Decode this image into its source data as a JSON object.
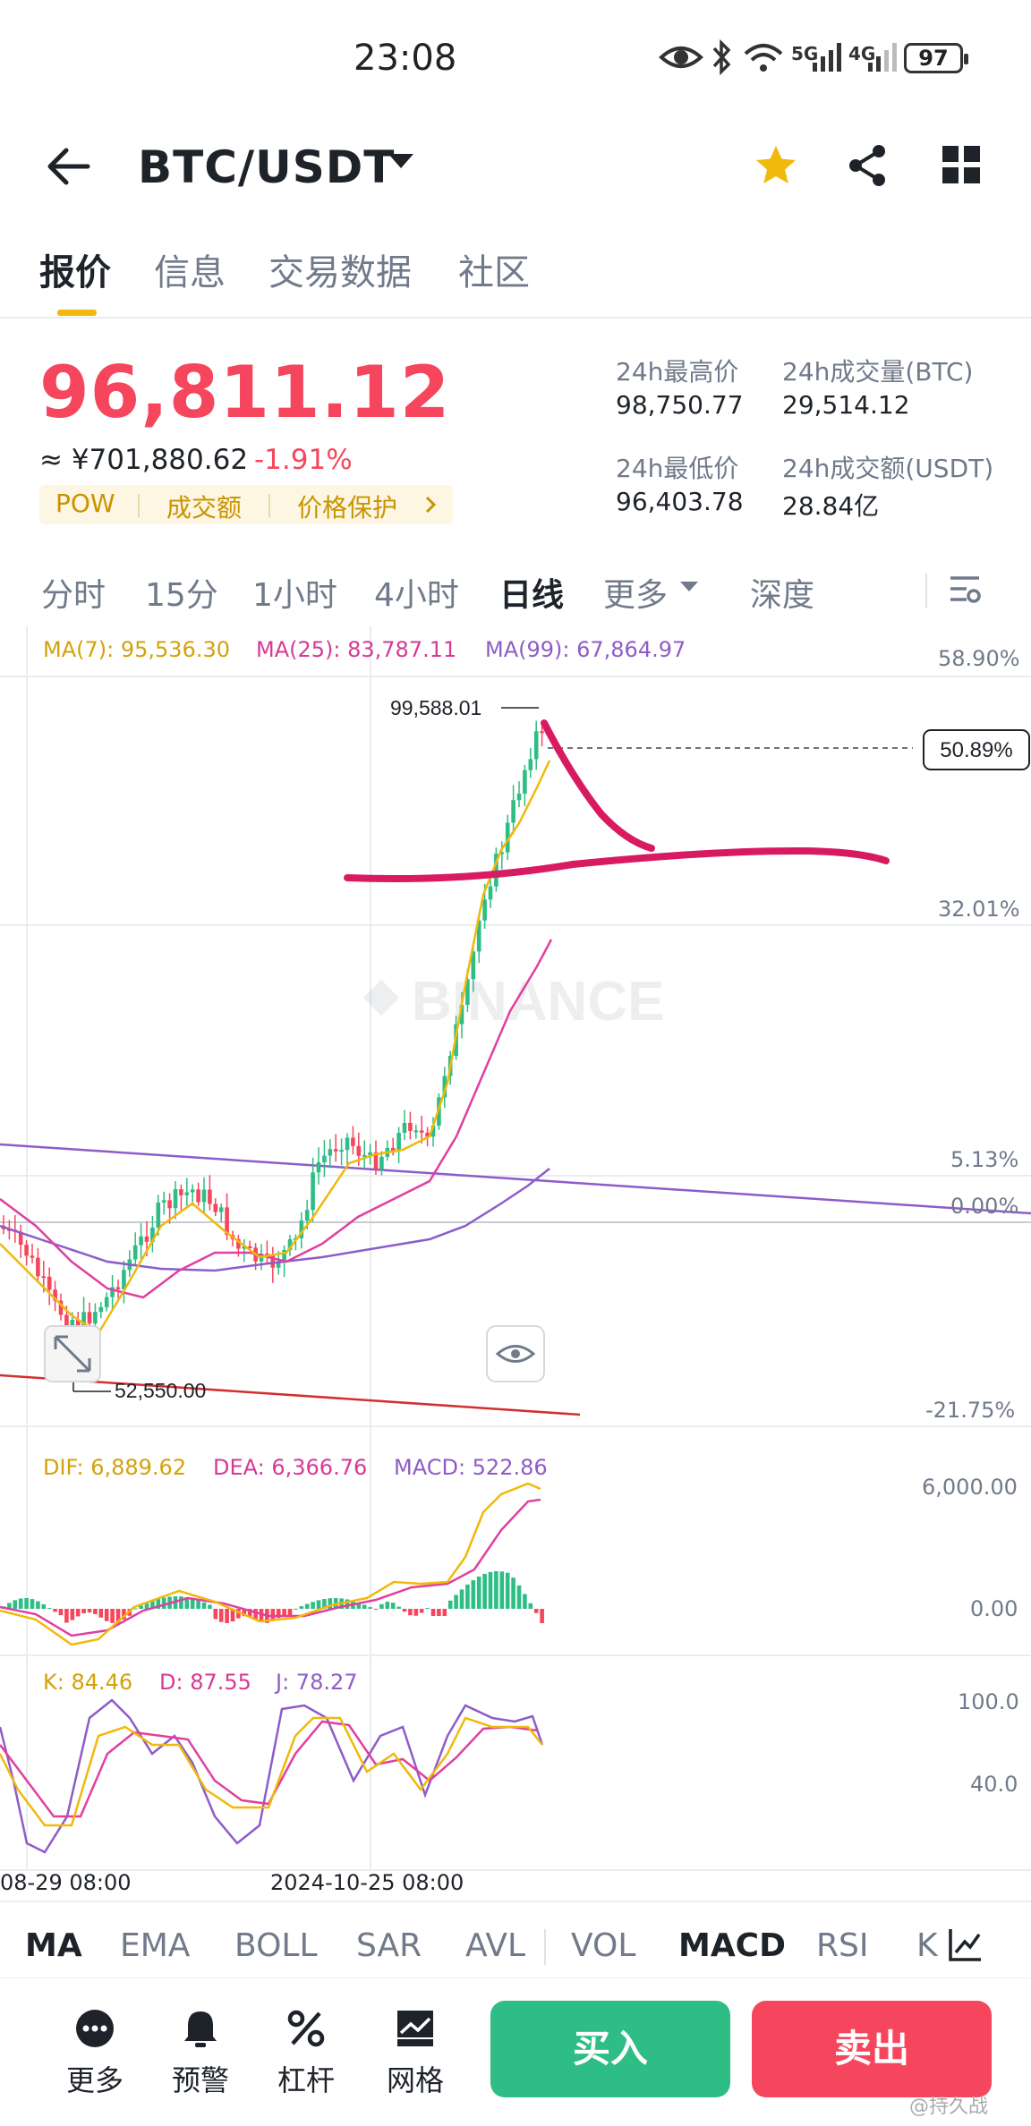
{
  "status_bar": {
    "time": "23:08",
    "battery": "97",
    "net1": "5G",
    "net2": "4G"
  },
  "header": {
    "pair": "BTC/USDT"
  },
  "tabs": [
    {
      "label": "报价",
      "active": true
    },
    {
      "label": "信息",
      "active": false
    },
    {
      "label": "交易数据",
      "active": false
    },
    {
      "label": "社区",
      "active": false
    }
  ],
  "price": {
    "last": "96,811.12",
    "cny": "≈ ¥701,880.62",
    "change": "-1.91%",
    "tags": [
      "POW",
      "成交额",
      "价格保护"
    ]
  },
  "stats": {
    "high_label": "24h最高价",
    "high": "98,750.77",
    "vol_btc_label": "24h成交量(BTC)",
    "vol_btc": "29,514.12",
    "low_label": "24h最低价",
    "low": "96,403.78",
    "vol_usdt_label": "24h成交额(USDT)",
    "vol_usdt": "28.84亿"
  },
  "intervals": [
    {
      "label": "分时",
      "active": false
    },
    {
      "label": "15分",
      "active": false
    },
    {
      "label": "1小时",
      "active": false
    },
    {
      "label": "4小时",
      "active": false
    },
    {
      "label": "日线",
      "active": true
    },
    {
      "label": "更多",
      "active": false
    },
    {
      "label": "深度",
      "active": false
    }
  ],
  "main_chart": {
    "ma7": "MA(7): 95,536.30",
    "ma25": "MA(25): 83,787.11",
    "ma99": "MA(99): 67,864.97",
    "high_marker": "99,588.01",
    "low_marker": "52,550.00",
    "current_pct": "50.89%",
    "watermark": "BINANCE",
    "axis": [
      "58.90%",
      "32.01%",
      "5.13%",
      "0.00%",
      "-21.75%"
    ],
    "colors": {
      "ma7": "#f0b90b",
      "ma25": "#e040a0",
      "ma99": "#8e5cc8",
      "up": "#2ebd85",
      "down": "#f6465d",
      "annotation": "#d81b60"
    }
  },
  "macd": {
    "dif": "DIF: 6,889.62",
    "dea": "DEA: 6,366.76",
    "macd": "MACD: 522.86",
    "axis": [
      "6,000.00",
      "0.00"
    ]
  },
  "kdj": {
    "k": "K: 84.46",
    "d": "D: 87.55",
    "j": "J: 78.27",
    "axis": [
      "100.0",
      "40.0"
    ]
  },
  "time_axis": [
    "08-29 08:00",
    "2024-10-25 08:00"
  ],
  "indicator_tabs": [
    {
      "label": "MA",
      "active": true
    },
    {
      "label": "EMA",
      "active": false
    },
    {
      "label": "BOLL",
      "active": false
    },
    {
      "label": "SAR",
      "active": false
    },
    {
      "label": "AVL",
      "active": false
    },
    {
      "label": "VOL",
      "active": false
    },
    {
      "label": "MACD",
      "active": true
    },
    {
      "label": "RSI",
      "active": false
    },
    {
      "label": "K",
      "active": false
    }
  ],
  "toolbar": {
    "more": "更多",
    "alert": "预警",
    "leverage": "杠杆",
    "grid": "网格",
    "buy": "买入",
    "sell": "卖出"
  },
  "watermark_tag": "@持久战"
}
